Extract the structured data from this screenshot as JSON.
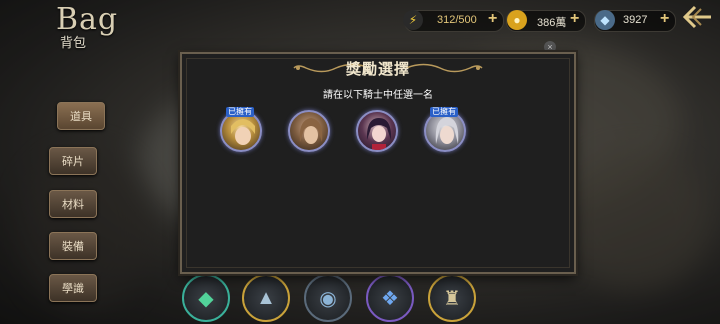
{
  "header": {
    "title": "Bag",
    "subtitle": "背包"
  },
  "resources": {
    "energy": {
      "icon": "lightning-icon",
      "value": "312/500"
    },
    "gold": {
      "icon": "gold-coin-icon",
      "value": "386萬"
    },
    "gems": {
      "icon": "crystal-icon",
      "value": "3927"
    }
  },
  "sidebar": {
    "tabs": [
      {
        "label": "道具",
        "active": true
      },
      {
        "label": "碎片",
        "active": false
      },
      {
        "label": "材料",
        "active": false
      },
      {
        "label": "裝備",
        "active": false
      },
      {
        "label": "學識",
        "active": false
      }
    ]
  },
  "modal": {
    "title": "獎勵選擇",
    "subtitle": "請在以下騎士中任選一名",
    "owned_label": "已擁有",
    "knights": [
      {
        "owned": true,
        "hair": "#e0c06a"
      },
      {
        "owned": false,
        "hair": "#7a5a3e"
      },
      {
        "owned": false,
        "hair": "#2e1e3a"
      },
      {
        "owned": true,
        "hair": "#c8c8d0"
      }
    ]
  },
  "colors": {
    "accent_gold": "#e3c67a",
    "owned_badge": "#2a60c8",
    "ring": "#8b8ec4"
  }
}
